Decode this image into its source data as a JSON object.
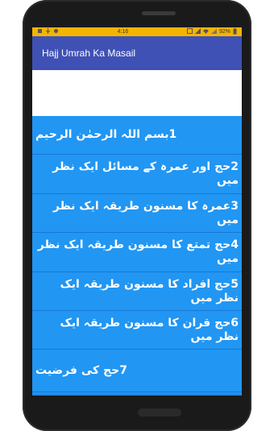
{
  "status_bar": {
    "left_icons": [
      "notification-icon",
      "usb-icon",
      "android-icon"
    ],
    "time": "4:16",
    "right_icons": [
      "nfc-icon",
      "signal-icon",
      "wifi-icon",
      "sim-icon"
    ],
    "battery": "92%"
  },
  "app_bar": {
    "title": "Hajj Umrah Ka Masail"
  },
  "list": {
    "items": [
      {
        "label": "1بسم اللہ الرحمٰن الرحیم"
      },
      {
        "label": "2حج اور عمرہ کے مسائل ایک نظر میں"
      },
      {
        "label": "3عمرہ کا مسنون طریقہ ایک نظر میں"
      },
      {
        "label": "4حج تمتع کا مسنون طریقہ ایک نظر میں"
      },
      {
        "label": "5حج افراد کا مسنون طریقہ ایک نظر میں"
      },
      {
        "label": "6حج قران کا مسنون طریقہ ایک نظر میں"
      },
      {
        "label": "7حج کی فرضیت"
      }
    ]
  },
  "colors": {
    "status_bar": "#f4b400",
    "app_bar": "#3f51b5",
    "list_bg": "#2196f3",
    "banner": "#ffffff"
  }
}
